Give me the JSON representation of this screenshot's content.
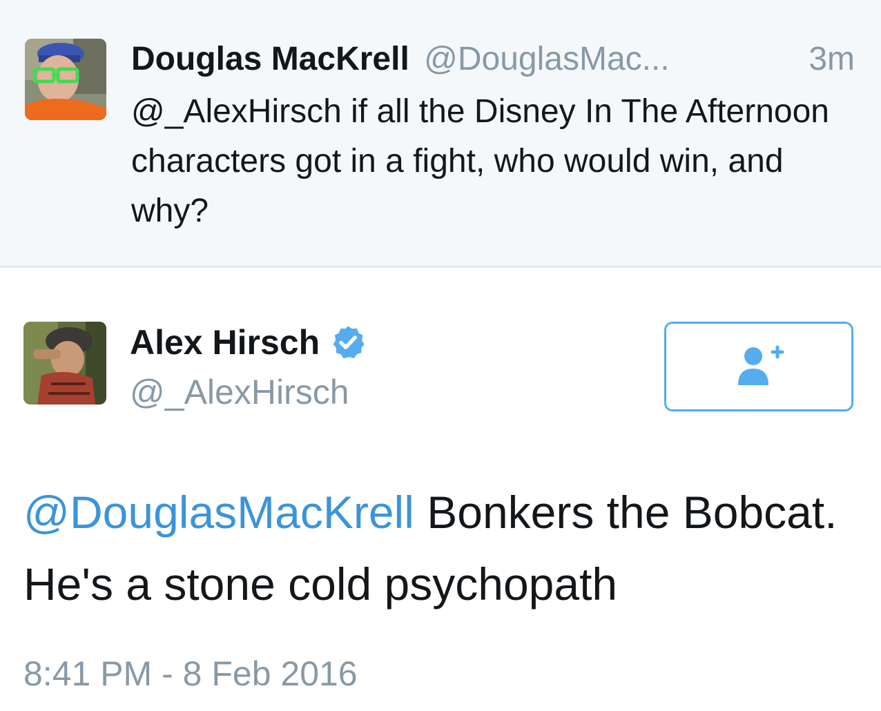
{
  "parent_tweet": {
    "author_name": "Douglas MacKrell",
    "author_handle": "@DouglasMac...",
    "time_ago": "3m",
    "text": "@_AlexHirsch if all the Disney In The Afternoon characters got in a fight, who would win, and why?",
    "avatar_icon": "user-avatar-sunglasses"
  },
  "main_tweet": {
    "author_name": "Alex Hirsch",
    "author_handle": "@_AlexHirsch",
    "verified_icon": "verified-badge-icon",
    "follow_icon": "follow-user-plus-icon",
    "mention": "@DouglasMacKrell",
    "text": " Bonkers the Bobcat. He's a stone cold psychopath",
    "timestamp": "8:41 PM - 8 Feb 2016",
    "avatar_icon": "user-avatar-hat"
  },
  "colors": {
    "link_blue": "#3b94d9",
    "accent_blue": "#55acee",
    "secondary_gray": "#8899a6",
    "text_dark": "#14171a",
    "divider": "#e1e8ed",
    "parent_bg": "#f5f8fa"
  }
}
